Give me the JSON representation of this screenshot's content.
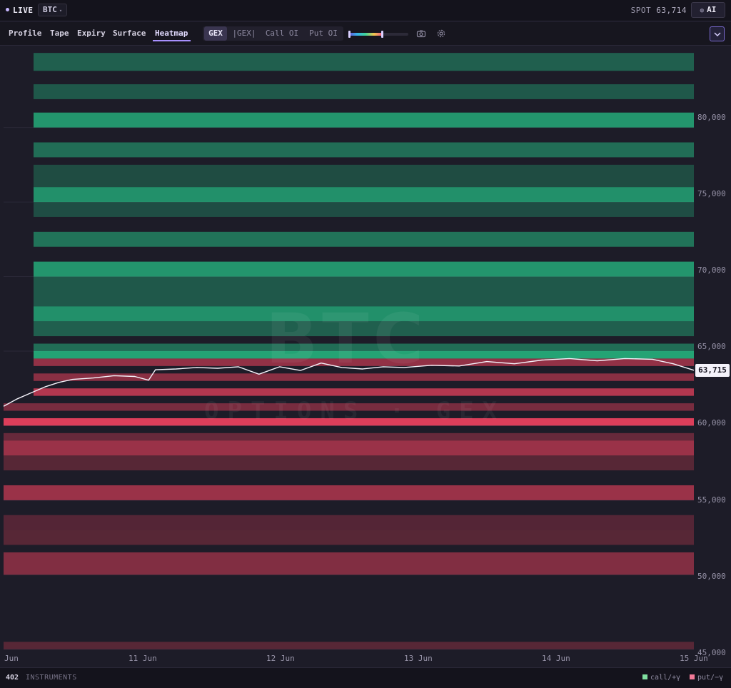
{
  "topbar": {
    "live_label": "LIVE",
    "symbol": "BTC",
    "spot_label": "SPOT",
    "spot_value": "63,714",
    "ai_label": "AI"
  },
  "tabs": [
    {
      "label": "Profile"
    },
    {
      "label": "Tape"
    },
    {
      "label": "Expiry"
    },
    {
      "label": "Surface"
    },
    {
      "label": "Heatmap",
      "active": true
    }
  ],
  "metric_toggle": [
    {
      "label": "GEX",
      "active": true
    },
    {
      "label": "|GEX|"
    },
    {
      "label": "Call OI"
    },
    {
      "label": "Put OI"
    }
  ],
  "colors": {
    "call_positive": "#26c98a",
    "put_negative": "#f2435f",
    "background": "#1d1c28",
    "accent": "#a890ff"
  },
  "icons": [
    "camera-icon",
    "gear-icon",
    "chevron-down-icon"
  ],
  "watermark": {
    "main": "BTC",
    "sub": "OPTIONS · GEX"
  },
  "chart_data": {
    "type": "heatmap",
    "title": "",
    "x_ticks": [
      "Jun",
      "11 Jun",
      "12 Jun",
      "13 Jun",
      "14 Jun",
      "15 Jun"
    ],
    "y_ticks": [
      "80,000",
      "75,000",
      "70,000",
      "65,000",
      "60,000",
      "55,000",
      "50,000",
      "45,000"
    ],
    "ylim": [
      44700,
      85200
    ],
    "xlim": [
      "10 Jun",
      "15 Jun"
    ],
    "current_price_label": "63,715",
    "bands": [
      {
        "strike_lo": 83800,
        "strike_hi": 85000,
        "sign": "call",
        "intensity": 0.35
      },
      {
        "strike_lo": 81900,
        "strike_hi": 82900,
        "sign": "call",
        "intensity": 0.3
      },
      {
        "strike_lo": 80000,
        "strike_hi": 81000,
        "sign": "call",
        "intensity": 0.75
      },
      {
        "strike_lo": 78000,
        "strike_hi": 79000,
        "sign": "call",
        "intensity": 0.45
      },
      {
        "strike_lo": 76000,
        "strike_hi": 77500,
        "sign": "call",
        "intensity": 0.2
      },
      {
        "strike_lo": 75000,
        "strike_hi": 76000,
        "sign": "call",
        "intensity": 0.7
      },
      {
        "strike_lo": 74000,
        "strike_hi": 75000,
        "sign": "call",
        "intensity": 0.22
      },
      {
        "strike_lo": 72000,
        "strike_hi": 73000,
        "sign": "call",
        "intensity": 0.5
      },
      {
        "strike_lo": 70000,
        "strike_hi": 71000,
        "sign": "call",
        "intensity": 0.75
      },
      {
        "strike_lo": 68000,
        "strike_hi": 70000,
        "sign": "call",
        "intensity": 0.3
      },
      {
        "strike_lo": 67000,
        "strike_hi": 68000,
        "sign": "call",
        "intensity": 0.7
      },
      {
        "strike_lo": 66000,
        "strike_hi": 67000,
        "sign": "call",
        "intensity": 0.35
      },
      {
        "strike_lo": 65000,
        "strike_hi": 65500,
        "sign": "call",
        "intensity": 0.45
      },
      {
        "strike_lo": 64500,
        "strike_hi": 65000,
        "sign": "call",
        "intensity": 0.85
      },
      {
        "strike_lo": 64000,
        "strike_hi": 64500,
        "sign": "put",
        "intensity": 0.55
      },
      {
        "strike_lo": 63000,
        "strike_hi": 63500,
        "sign": "put",
        "intensity": 0.5
      },
      {
        "strike_lo": 62000,
        "strike_hi": 62500,
        "sign": "put",
        "intensity": 0.75
      },
      {
        "strike_lo": 61000,
        "strike_hi": 61500,
        "sign": "put",
        "intensity": 0.4
      },
      {
        "strike_lo": 60000,
        "strike_hi": 60500,
        "sign": "put",
        "intensity": 1.0
      },
      {
        "strike_lo": 59000,
        "strike_hi": 59500,
        "sign": "put",
        "intensity": 0.3
      },
      {
        "strike_lo": 58000,
        "strike_hi": 59000,
        "sign": "put",
        "intensity": 0.6
      },
      {
        "strike_lo": 57000,
        "strike_hi": 58000,
        "sign": "put",
        "intensity": 0.2
      },
      {
        "strike_lo": 55000,
        "strike_hi": 56000,
        "sign": "put",
        "intensity": 0.6
      },
      {
        "strike_lo": 53000,
        "strike_hi": 54000,
        "sign": "put",
        "intensity": 0.18
      },
      {
        "strike_lo": 52000,
        "strike_hi": 53000,
        "sign": "put",
        "intensity": 0.2
      },
      {
        "strike_lo": 50000,
        "strike_hi": 51500,
        "sign": "put",
        "intensity": 0.45
      },
      {
        "strike_lo": 45000,
        "strike_hi": 45500,
        "sign": "put",
        "intensity": 0.2
      }
    ],
    "price_series": [
      {
        "t": 0.0,
        "p": 61300
      },
      {
        "t": 0.02,
        "p": 61800
      },
      {
        "t": 0.04,
        "p": 62200
      },
      {
        "t": 0.06,
        "p": 62600
      },
      {
        "t": 0.08,
        "p": 62900
      },
      {
        "t": 0.1,
        "p": 63100
      },
      {
        "t": 0.13,
        "p": 63200
      },
      {
        "t": 0.16,
        "p": 63350
      },
      {
        "t": 0.19,
        "p": 63300
      },
      {
        "t": 0.21,
        "p": 63050
      },
      {
        "t": 0.22,
        "p": 63750
      },
      {
        "t": 0.25,
        "p": 63800
      },
      {
        "t": 0.28,
        "p": 63900
      },
      {
        "t": 0.31,
        "p": 63850
      },
      {
        "t": 0.34,
        "p": 63950
      },
      {
        "t": 0.37,
        "p": 63450
      },
      {
        "t": 0.4,
        "p": 63950
      },
      {
        "t": 0.43,
        "p": 63700
      },
      {
        "t": 0.46,
        "p": 64200
      },
      {
        "t": 0.49,
        "p": 63900
      },
      {
        "t": 0.52,
        "p": 63800
      },
      {
        "t": 0.55,
        "p": 63950
      },
      {
        "t": 0.58,
        "p": 63900
      },
      {
        "t": 0.62,
        "p": 64050
      },
      {
        "t": 0.66,
        "p": 64000
      },
      {
        "t": 0.7,
        "p": 64300
      },
      {
        "t": 0.74,
        "p": 64150
      },
      {
        "t": 0.78,
        "p": 64400
      },
      {
        "t": 0.82,
        "p": 64500
      },
      {
        "t": 0.86,
        "p": 64350
      },
      {
        "t": 0.9,
        "p": 64500
      },
      {
        "t": 0.94,
        "p": 64450
      },
      {
        "t": 0.97,
        "p": 64150
      },
      {
        "t": 1.0,
        "p": 63715
      }
    ]
  },
  "footer": {
    "instrument_count": "402",
    "instrument_label": "INSTRUMENTS",
    "legend_call": "call/+γ",
    "legend_put": "put/−γ"
  }
}
